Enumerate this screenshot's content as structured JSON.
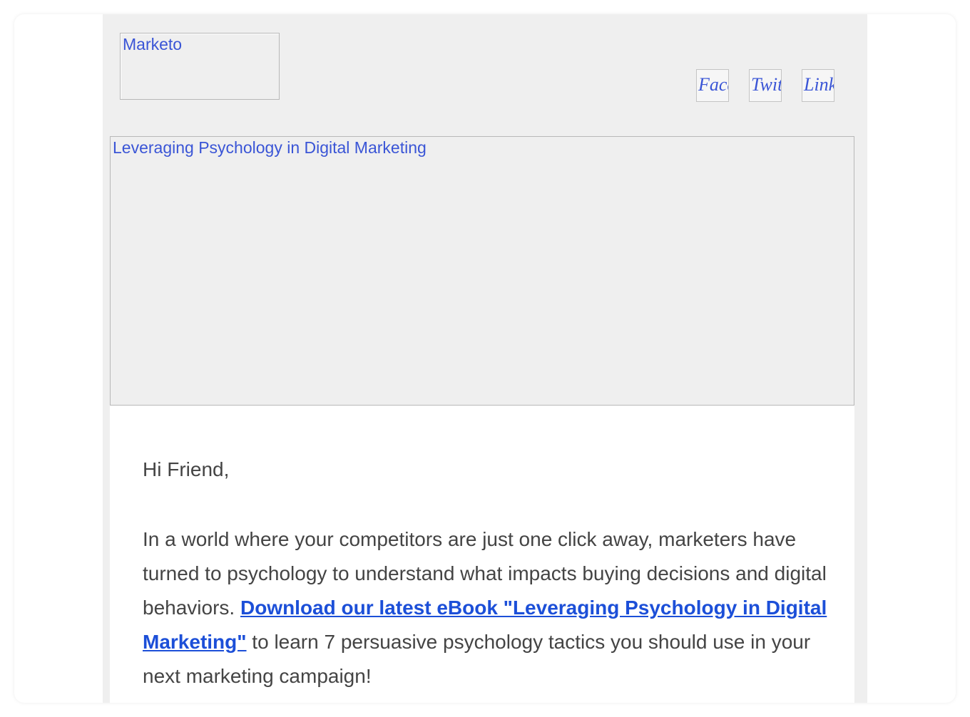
{
  "header": {
    "logo_alt": "Marketo",
    "social": [
      {
        "alt": "Facebook"
      },
      {
        "alt": "Twitter"
      },
      {
        "alt": "LinkedIn"
      }
    ]
  },
  "hero": {
    "alt": "Leveraging Psychology in Digital Marketing"
  },
  "body": {
    "greeting": "Hi Friend,",
    "para_before_link": "In a world where your competitors are just one click away, marketers have turned to psychology to understand what impacts buying decisions and digital behaviors. ",
    "link_text": "Download our latest eBook \"Leveraging Psychology in Digital Marketing\"",
    "para_after_link": " to learn 7 persuasive psychology tactics you should use in your next marketing campaign!"
  },
  "colors": {
    "link": "#1c4fd8",
    "alt_text": "#3a55d6",
    "body_text": "#444444",
    "email_bg": "#efefef"
  }
}
